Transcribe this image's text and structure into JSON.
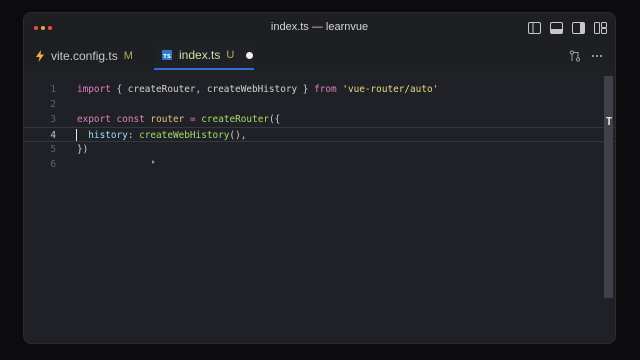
{
  "window": {
    "title": "index.ts — learnvue"
  },
  "tabs": [
    {
      "label": "vite.config.ts",
      "status": "M",
      "icon": "lightning-icon"
    },
    {
      "label": "index.ts",
      "status": "U",
      "icon": "typescript-icon"
    }
  ],
  "editor": {
    "active_line": 4,
    "lines": [
      {
        "num": "1",
        "tokens": [
          {
            "t": "import",
            "c": "kw"
          },
          {
            "t": " { createRouter, createWebHistory } ",
            "c": "punc"
          },
          {
            "t": "from",
            "c": "kw"
          },
          {
            "t": " ",
            "c": "punc"
          },
          {
            "t": "'vue-router/auto'",
            "c": "str"
          }
        ]
      },
      {
        "num": "2",
        "tokens": []
      },
      {
        "num": "3",
        "tokens": [
          {
            "t": "export",
            "c": "kw"
          },
          {
            "t": " ",
            "c": "punc"
          },
          {
            "t": "const",
            "c": "kw"
          },
          {
            "t": " ",
            "c": "punc"
          },
          {
            "t": "router",
            "c": "var"
          },
          {
            "t": " ",
            "c": "punc"
          },
          {
            "t": "=",
            "c": "kw"
          },
          {
            "t": " ",
            "c": "punc"
          },
          {
            "t": "createRouter",
            "c": "fn"
          },
          {
            "t": "({",
            "c": "punc"
          }
        ]
      },
      {
        "num": "4",
        "tokens": [
          {
            "t": "  history",
            "c": "prop"
          },
          {
            "t": ": ",
            "c": "punc"
          },
          {
            "t": "createWebHistory",
            "c": "fn"
          },
          {
            "t": "(),",
            "c": "punc"
          }
        ]
      },
      {
        "num": "5",
        "tokens": [
          {
            "t": "})",
            "c": "punc"
          }
        ]
      },
      {
        "num": "6",
        "tokens": []
      }
    ]
  },
  "colors": {
    "accent": "#2f6fd1",
    "keyword": "#e07fbf",
    "function": "#a6dc6a",
    "string": "#e6d987"
  }
}
